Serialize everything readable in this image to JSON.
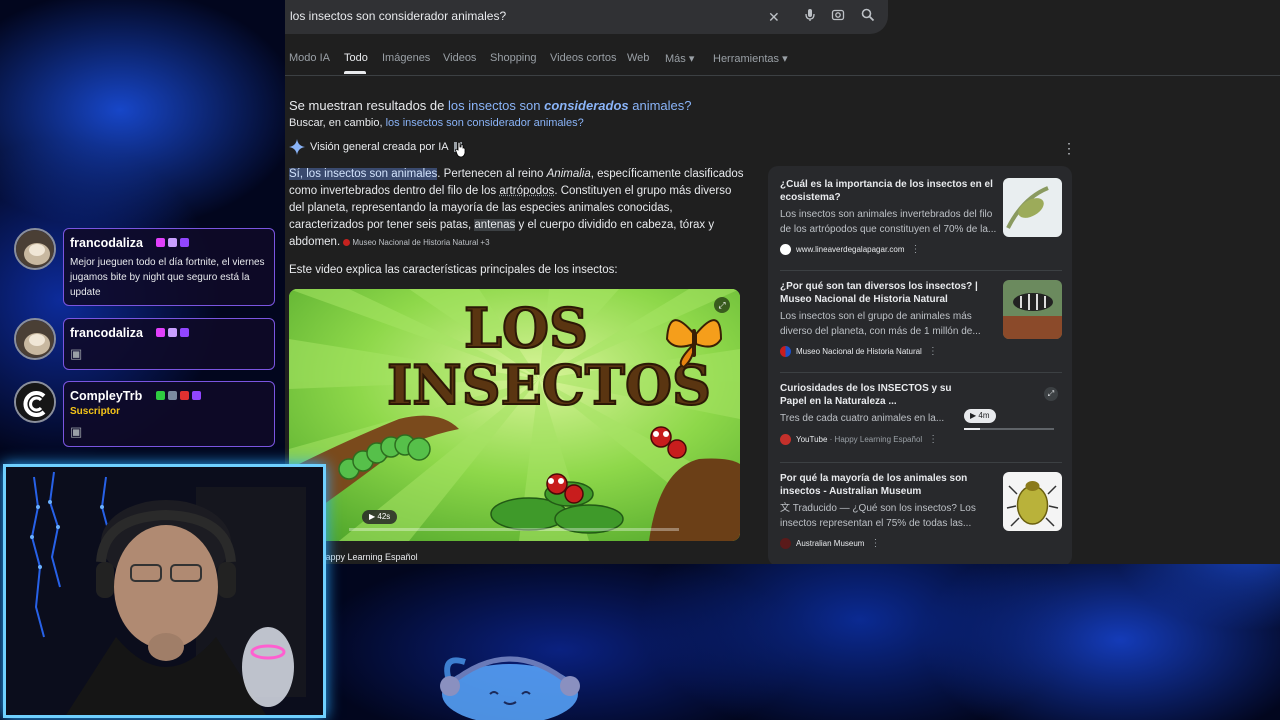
{
  "search": {
    "query": "los insectos son considerador animales?",
    "clear_icon": "close-icon",
    "mic_icon": "mic-icon",
    "lens_icon": "camera-lens-icon",
    "search_icon": "search-icon"
  },
  "tabs": [
    {
      "label": "Modo IA"
    },
    {
      "label": "Todo"
    },
    {
      "label": "Imágenes"
    },
    {
      "label": "Videos"
    },
    {
      "label": "Shopping"
    },
    {
      "label": "Videos cortos"
    },
    {
      "label": "Web"
    },
    {
      "label": "Más ▾"
    },
    {
      "label": "Herramientas ▾"
    }
  ],
  "spelling": {
    "prefix": "Se muestran resultados de ",
    "corrected_a": "los insectos son ",
    "corrected_b": "considerados",
    "corrected_c": " animales?",
    "instead_prefix": "Buscar, en cambio, ",
    "instead_link": "los insectos son considerador animales?"
  },
  "ai_overview": {
    "label": "Visión general creada por IA",
    "p1_hl": "Sí, los insectos son animales",
    "p1_a": ". Pertenecen al reino ",
    "p1_it": "Animalia",
    "p1_b": ", específicamente clasificados como invertebrados dentro del filo de los ",
    "p1_ul": "artrópodos",
    "p1_c": ". Constituyen el grupo más diverso del planeta, representando la mayoría de las especies animales conocidas, caracterizados por tener seis patas, ",
    "p1_hl2": "antenas",
    "p1_d": " y el cuerpo dividido en cabeza, tórax y abdomen.",
    "source_chip": "Museo Nacional de Historia Natural +3",
    "video_caption": "Este video explica las características principales de los insectos:",
    "video_title_l1": "LOS",
    "video_title_l2": "INSECTOS",
    "video_duration": "▶ 42s",
    "video_channel": "Happy Learning Español"
  },
  "right_results": [
    {
      "title": "¿Cuál es la importancia de los insectos en el ecosistema?",
      "snippet": "Los insectos son animales invertebrados del filo de los artrópodos que constituyen el 70% de la...",
      "source": "www.lineaverdegalapagar.com"
    },
    {
      "title": "¿Por qué son tan diversos los insectos? | Museo Nacional de Historia Natural",
      "snippet": "Los insectos son el grupo de animales más diverso del planeta, con más de 1 millón de...",
      "source": "Museo Nacional de Historia Natural"
    },
    {
      "title": "Curiosidades de los INSECTOS y su Papel en la Naturaleza ...",
      "snippet": "Tres de cada cuatro animales en la...",
      "source": "YouTube",
      "source_extra": " · Happy Learning Español",
      "duration": "▶ 4m"
    },
    {
      "title": "Por qué la mayoría de los animales son insectos - Australian Museum",
      "snippet": "文 Traducido — ¿Qué son los insectos? Los insectos representan el 75% de todas las...",
      "source": "Australian Museum"
    }
  ],
  "chat": [
    {
      "user": "francodaliza",
      "text": "Mejor jueguen todo el día fortnite, el viernes jugamos bite by night que seguro está la update"
    },
    {
      "user": "francodaliza",
      "text": "▣"
    },
    {
      "user": "CompleyTrb",
      "role": "Suscriptor",
      "text": "▣"
    }
  ],
  "colors": {
    "accent_link": "#8ab4f8",
    "chat_border": "#7a55e0",
    "webcam_border": "#6fd0ff",
    "subscriber": "#f5c518"
  }
}
